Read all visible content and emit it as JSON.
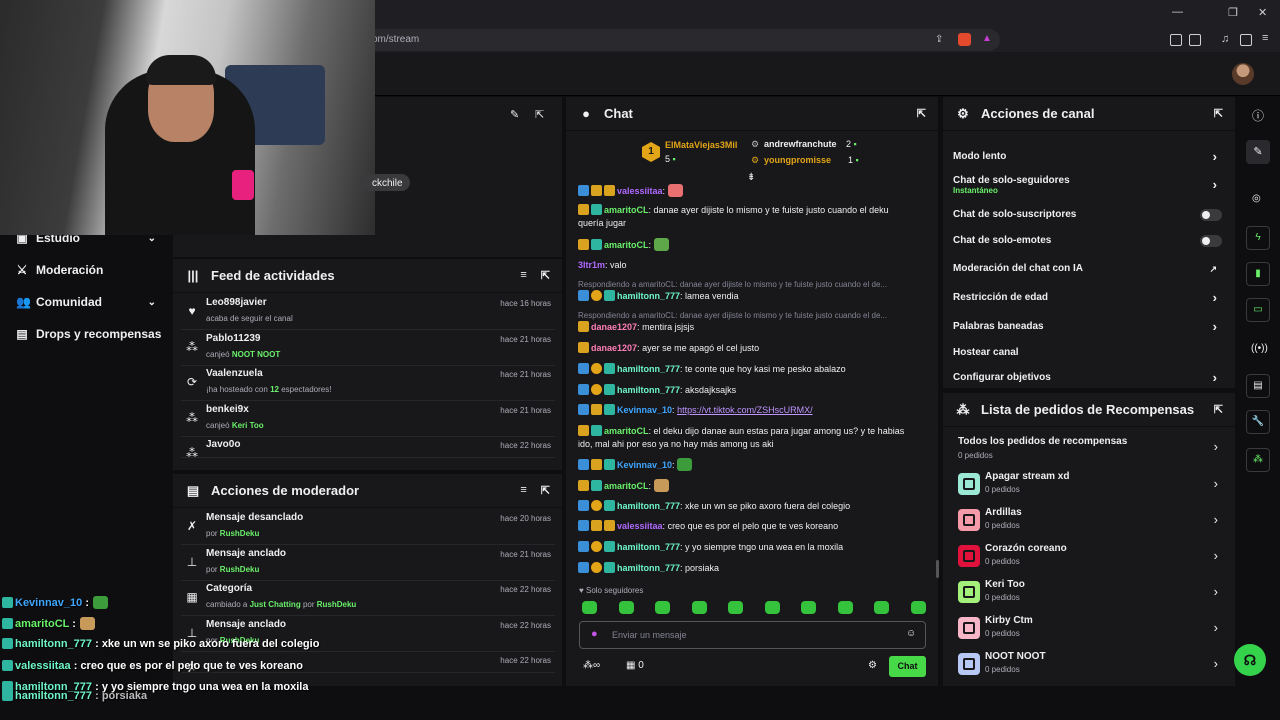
{
  "browser": {
    "url_text": "om/stream"
  },
  "webcam": {
    "overlay_text": "ckchile"
  },
  "left_nav": {
    "items": [
      {
        "label": "Estudio",
        "has_chevron": true
      },
      {
        "label": "Moderación",
        "has_chevron": false
      },
      {
        "label": "Comunidad",
        "has_chevron": true
      },
      {
        "label": "Drops y recompensas",
        "has_chevron": false
      }
    ]
  },
  "activity_feed": {
    "title": "Feed de actividades",
    "items": [
      {
        "icon": "heart-icon",
        "name": "Leo898javier",
        "text": "acaba de seguir el canal",
        "highlight": "",
        "text_after": "",
        "time": "hace 16 horas"
      },
      {
        "icon": "points-icon",
        "name": "Pablo11239",
        "text": "canjeó",
        "highlight": "NOOT NOOT",
        "text_after": "",
        "time": "hace 21 horas"
      },
      {
        "icon": "host-icon",
        "name": "Vaalenzuela",
        "text": "¡ha hosteado con",
        "highlight": "12",
        "text_after": "espectadores!",
        "time": "hace 21 horas"
      },
      {
        "icon": "points-icon",
        "name": "benkei9x",
        "text": "canjeó",
        "highlight": "Keri Too",
        "text_after": "",
        "time": "hace 21 horas"
      },
      {
        "icon": "points-icon",
        "name": "Javo0o",
        "text": "canjeó",
        "highlight": "Keri Too",
        "text_after": "",
        "time": "hace 22 horas"
      }
    ]
  },
  "mod_actions": {
    "title": "Acciones de moderador",
    "items": [
      {
        "icon": "unpin-icon",
        "name": "Mensaje desanclado",
        "text": "por",
        "highlight": "RushDeku",
        "time": "hace 20 horas"
      },
      {
        "icon": "pin-icon",
        "name": "Mensaje anclado",
        "text": "por",
        "highlight": "RushDeku",
        "time": "hace 21 horas"
      },
      {
        "icon": "category-icon",
        "name": "Categoría",
        "text": "cambiado a",
        "highlight": "Just Chatting",
        "text_after": "por",
        "highlight2": "RushDeku",
        "time": "hace 22 horas"
      },
      {
        "icon": "pin-icon",
        "name": "Mensaje anclado",
        "text": "por",
        "highlight": "RushDeku",
        "time": "hace 22 horas"
      },
      {
        "icon": "unpin-icon",
        "name": "",
        "text": "",
        "highlight": "",
        "time": "hace 22 horas"
      }
    ]
  },
  "chat": {
    "title": "Chat",
    "leaderboard": {
      "first": {
        "rank": "1",
        "name": "ElMataViejas3Mil",
        "count": "5"
      },
      "second": {
        "name": "andrewfranchute",
        "count": "2"
      },
      "third": {
        "name": "youngpromisse",
        "count": "1"
      }
    },
    "messages": [
      {
        "user": "valessiitaa",
        "color": "purple",
        "text": ""
      },
      {
        "user": "amaritoCL",
        "color": "green",
        "text": "danae ayer dijiste lo mismo y te fuiste justo cuando el deku"
      },
      {
        "user": "",
        "color": "",
        "text": "quería jugar"
      },
      {
        "user": "amaritoCL",
        "color": "green",
        "text": ""
      },
      {
        "user": "3ltr1m",
        "color": "purple",
        "text": "valo"
      },
      {
        "reply": "Respondiendo a amaritoCL: danae ayer dijiste lo mismo y te fuiste justo cuando el de..."
      },
      {
        "user": "hamiltonn_777",
        "color": "cyan",
        "text": "lamea vendia"
      },
      {
        "reply": "Respondiendo a amaritoCL: danae ayer dijiste lo mismo y te fuiste justo cuando el de..."
      },
      {
        "user": "danae1207",
        "color": "pink",
        "text": "mentira jsjsjs"
      },
      {
        "user": "danae1207",
        "color": "pink",
        "text": "ayer se me apagó el cel justo"
      },
      {
        "user": "hamiltonn_777",
        "color": "cyan",
        "text": "te conte que hoy kasi me pesko abalazo"
      },
      {
        "user": "hamiltonn_777",
        "color": "cyan",
        "text": "aksdajksajks"
      },
      {
        "user": "Kevinnav_10",
        "color": "blue",
        "text": "https://vt.tiktok.com/ZSHscURMX/"
      },
      {
        "user": "amaritoCL",
        "color": "green",
        "text": "el deku dijo danae aun estas para jugar among us? y te habias"
      },
      {
        "user": "",
        "color": "",
        "text": "ido, mal ahi por eso ya no hay más among us aki"
      },
      {
        "user": "Kevinnav_10",
        "color": "blue",
        "text": ""
      },
      {
        "user": "amaritoCL",
        "color": "green",
        "text": ""
      },
      {
        "user": "hamiltonn_777",
        "color": "cyan",
        "text": "xke un wn se piko axoro fuera del colegio"
      },
      {
        "user": "valessiitaa",
        "color": "purple",
        "text": "creo que es por el pelo que te ves koreano"
      },
      {
        "user": "hamiltonn_777",
        "color": "cyan",
        "text": "y yo siempre tngo una wea en la moxila"
      },
      {
        "user": "hamiltonn_777",
        "color": "cyan",
        "text": "porsiaka"
      }
    ],
    "followers_only": "Solo seguidores",
    "input_placeholder": "Enviar un mensaje",
    "points_value": "0",
    "send_label": "Chat"
  },
  "channel_actions": {
    "title": "Acciones de canal",
    "items": [
      {
        "label": "Modo lento",
        "sub": "",
        "control": "chevron"
      },
      {
        "label": "Chat de solo-seguidores",
        "sub": "Instantáneo",
        "control": "chevron"
      },
      {
        "label": "Chat de solo-suscriptores",
        "sub": "",
        "control": "toggle"
      },
      {
        "label": "Chat de solo-emotes",
        "sub": "",
        "control": "toggle"
      },
      {
        "label": "Moderación del chat con IA",
        "sub": "",
        "control": "external"
      },
      {
        "label": "Restricción de edad",
        "sub": "",
        "control": "chevron"
      },
      {
        "label": "Palabras baneadas",
        "sub": "",
        "control": "chevron"
      },
      {
        "label": "Hostear canal",
        "sub": "",
        "control": "none"
      },
      {
        "label": "Configurar objetivos",
        "sub": "",
        "control": "chevron"
      }
    ]
  },
  "rewards": {
    "title": "Lista de pedidos de Recompensas",
    "all_label": "Todos los pedidos de recompensas",
    "all_sub": "0 pedidos",
    "items": [
      {
        "name": "Apagar stream xd",
        "sub": "0 pedidos",
        "color": "#9be8d4"
      },
      {
        "name": "Ardillas",
        "sub": "0 pedidos",
        "color": "#f59aa8"
      },
      {
        "name": "Corazón coreano",
        "sub": "0 pedidos",
        "color": "#e0123c"
      },
      {
        "name": "Keri Too",
        "sub": "0 pedidos",
        "color": "#a3f07a"
      },
      {
        "name": "Kirby Ctm",
        "sub": "0 pedidos",
        "color": "#f7b5c8"
      },
      {
        "name": "NOOT NOOT",
        "sub": "0 pedidos",
        "color": "#b8c8f4"
      }
    ]
  },
  "stream_overlay": {
    "lines": [
      {
        "user": "Kevinnav_10",
        "text": ":"
      },
      {
        "user": "amaritoCL",
        "text": ":"
      },
      {
        "user": "hamiltonn_777",
        "text": ": xke un wn se piko axoro fuera del colegio"
      },
      {
        "user": "valessiitaa",
        "text": ": creo que es por el pelo que te ves koreano"
      },
      {
        "user": "hamiltonn_777",
        "text": ": y yo siempre tngo una wea en la moxila"
      },
      {
        "user": "hamiltonn_777",
        "text": ": porsiaka"
      }
    ]
  }
}
